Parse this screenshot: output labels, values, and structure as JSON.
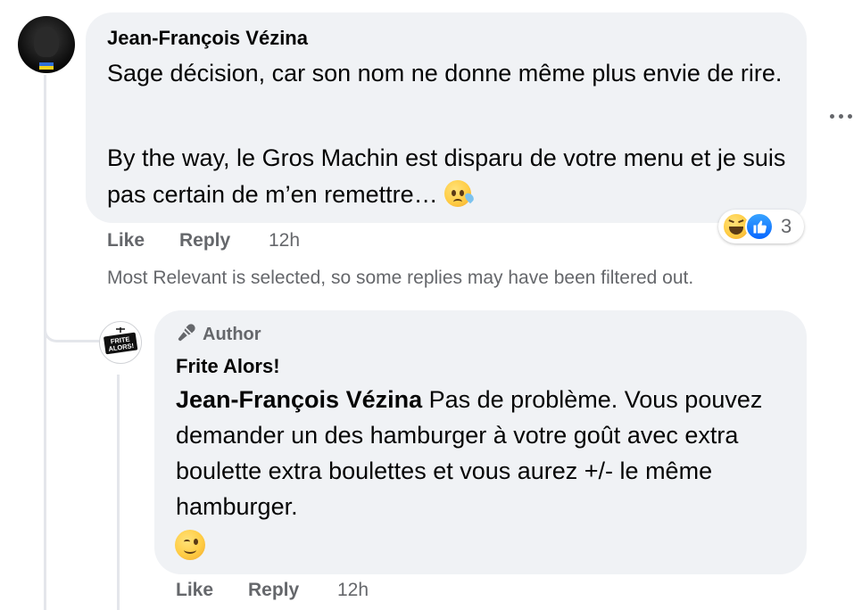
{
  "comment": {
    "author": "Jean-François Vézina",
    "paragraph1": "Sage décision, car son nom ne donne même plus envie de rire.",
    "paragraph2": "By the way, le Gros Machin est disparu de votre menu et je suis pas certain de m’en remettre…",
    "paragraph2_emoji": "sad-relieved-face",
    "like_label": "Like",
    "reply_label": "Reply",
    "time": "12h",
    "reactions": {
      "count": "3",
      "types": [
        "laughing-face",
        "like-thumb"
      ]
    }
  },
  "filter_notice": "Most Relevant is selected, so some replies may have been filtered out.",
  "reply": {
    "badge": "Author",
    "author": "Frite Alors!",
    "avatar_logo_text": "FRITE ALORS!",
    "mention": "Jean-François Vézina",
    "text": "Pas de problème. Vous pouvez demander un des hamburger à votre goût avec extra boulette extra boulettes et vous aurez +/- le même hamburger.",
    "emoji": "winking-face",
    "like_label": "Like",
    "reply_label": "Reply",
    "time": "12h"
  },
  "colors": {
    "bubble": "#f0f2f5",
    "secondary_text": "#65676b",
    "like_blue": "#0866ff"
  }
}
